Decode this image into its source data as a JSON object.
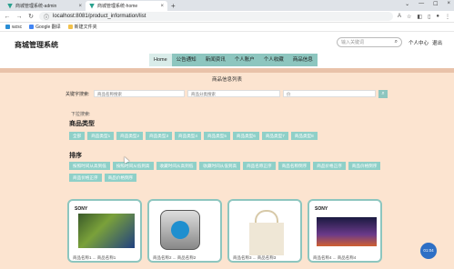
{
  "browser": {
    "tabs": [
      {
        "label": "商城管理系统-admin",
        "close": "×"
      },
      {
        "label": "商城管理系统-home",
        "close": "×"
      }
    ],
    "newtab": "+",
    "window_controls": [
      "⌄",
      "—",
      "☐",
      "×"
    ],
    "url": "localhost:8081/product_information/list",
    "bookmarks": [
      "wzsc",
      "Google 翻译",
      "新建文件夹"
    ]
  },
  "header": {
    "title": "商城管理系统",
    "search_placeholder": "输入关键词",
    "user_center": "个人中心",
    "logout": "退出"
  },
  "nav": [
    "Home",
    "公告通知",
    "新闻资讯",
    "个人账户",
    "个人收藏",
    "商品信息"
  ],
  "main": {
    "list_title": "商品信息列表",
    "keyword_label": "关键字搜索:",
    "inputs": [
      "商品名称搜索",
      "商品分类搜索",
      "价"
    ],
    "hint": "下拉搜索:",
    "category_title": "商品类型",
    "categories": [
      "全部",
      "商品类型1",
      "商品类型2",
      "商品类型3",
      "商品类型4",
      "商品类型5",
      "商品类型6",
      "商品类型7",
      "商品类型8"
    ],
    "sort_title": "排序",
    "sort_options": [
      "按照时间从高到低",
      "按照时间从低到高",
      "收藏时间从高到低",
      "收藏时间从低到高",
      "商品名称正序",
      "商品名称倒序",
      "商品价格正序",
      "商品价格倒序",
      "商品价格正序",
      "商品价格倒序"
    ]
  },
  "cards": [
    {
      "brand": "SONY",
      "caption": "商品名称1 ... 商品名称1"
    },
    {
      "brand": "",
      "caption": "商品名称2 ... 商品名称2"
    },
    {
      "brand": "",
      "caption": "商品名称3 ... 商品名称3"
    },
    {
      "brand": "SONY",
      "caption": "商品名称4 ... 商品名称4"
    }
  ],
  "fab": "01:04",
  "colors": {
    "teal": "#8dc6bf",
    "page_bg": "#fce4d0",
    "chip": "#8fd0c8"
  }
}
